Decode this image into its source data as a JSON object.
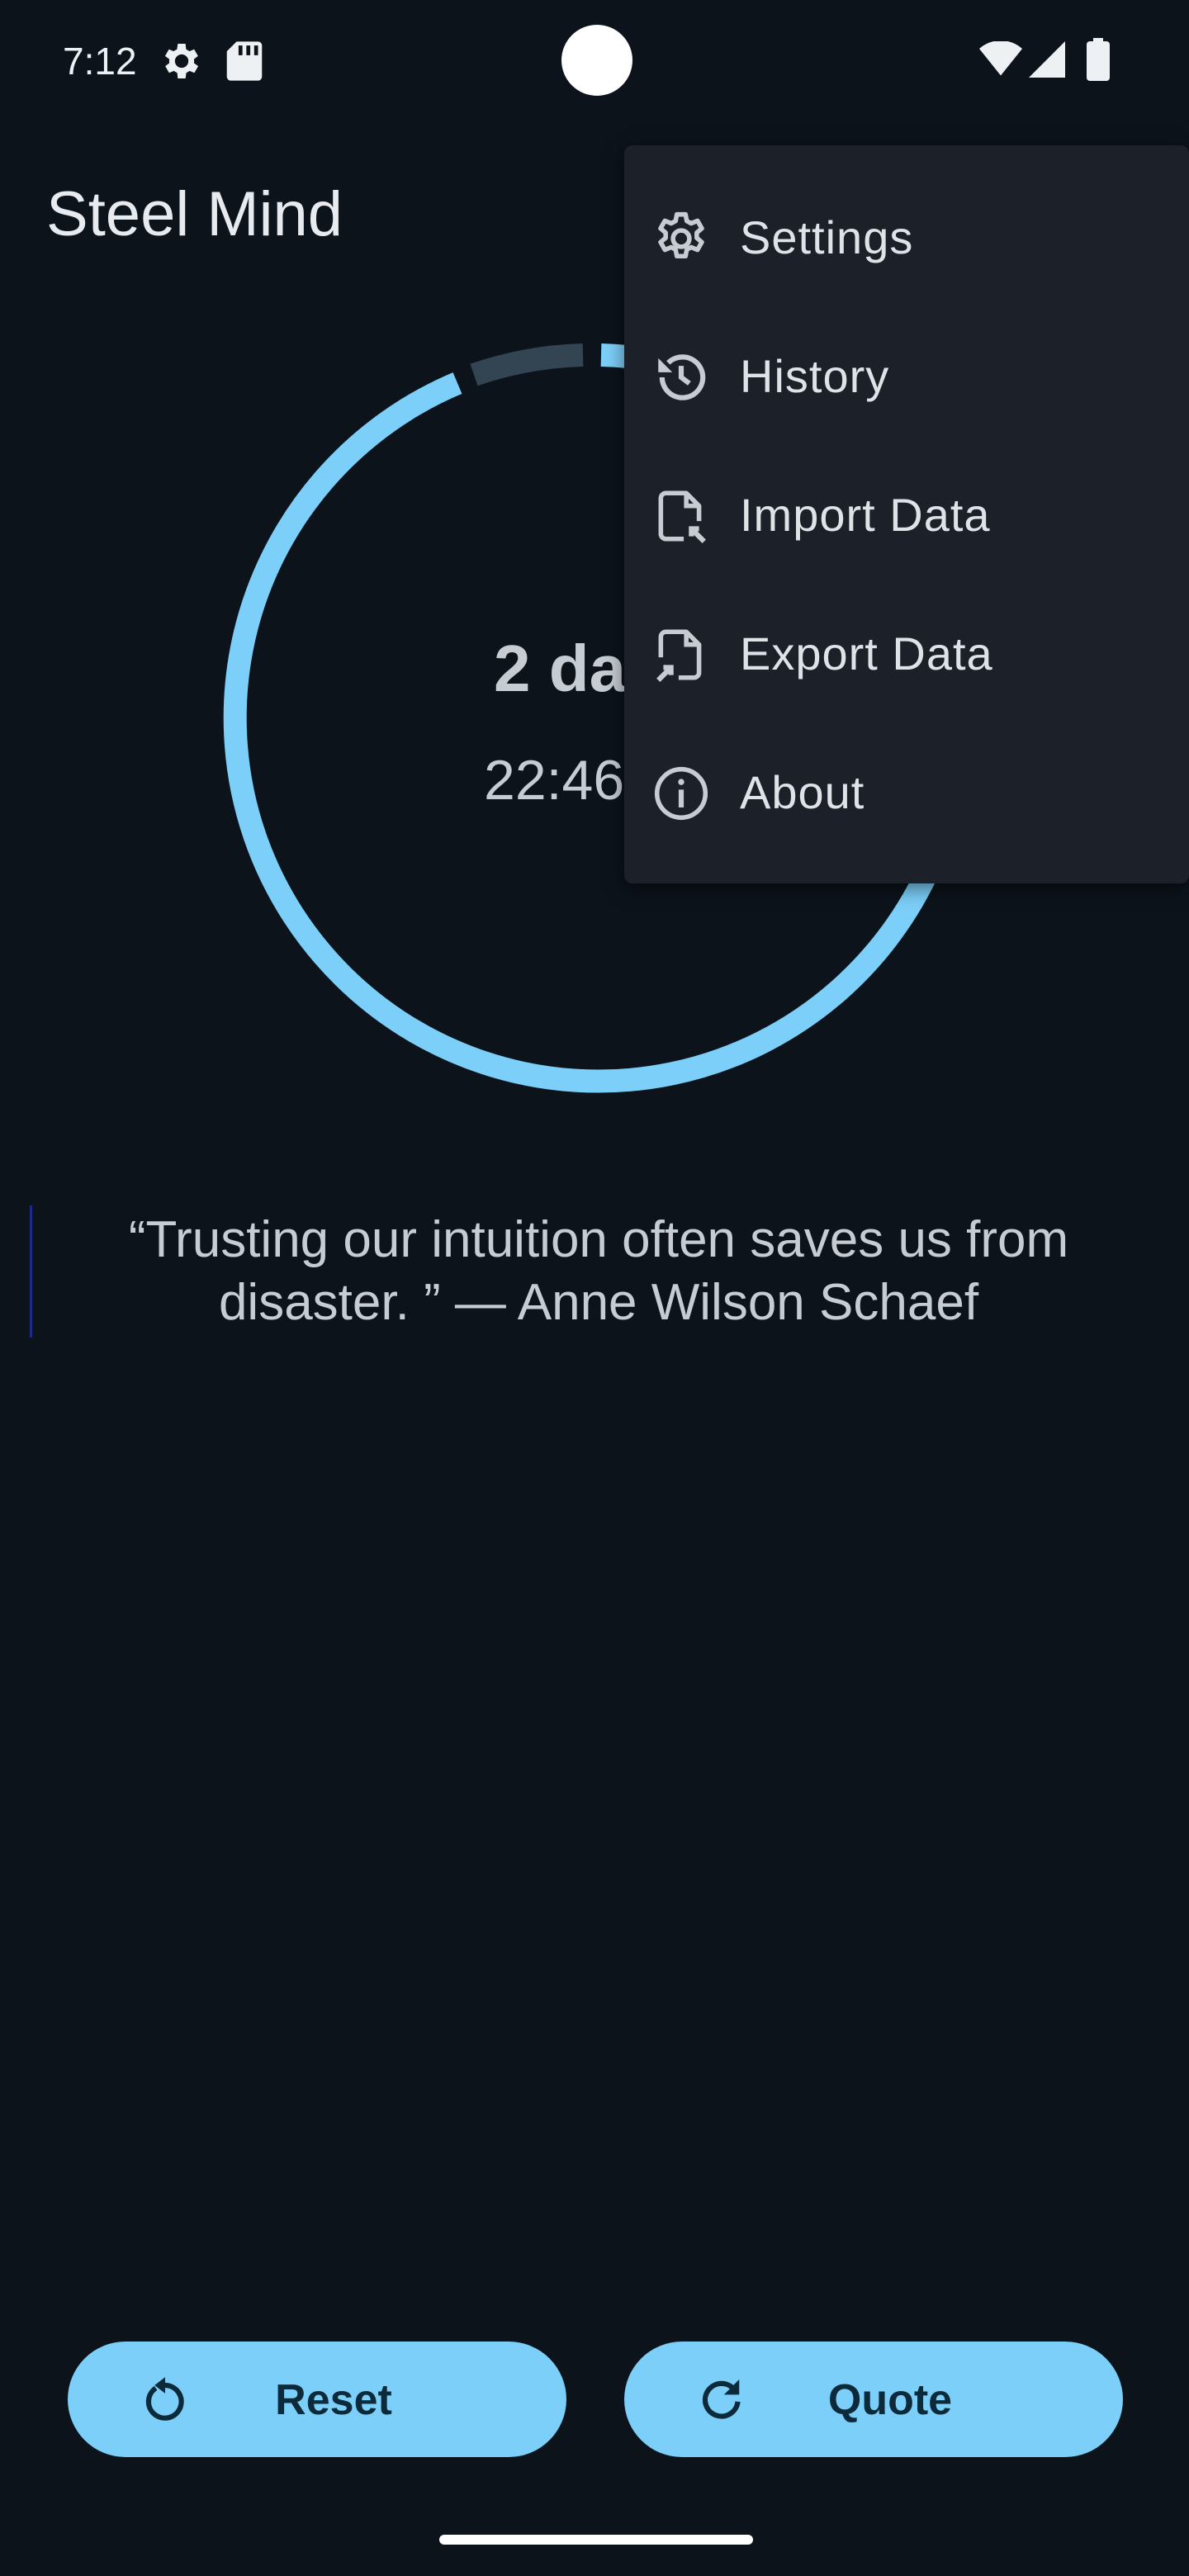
{
  "status_bar": {
    "time": "7:12",
    "icons": [
      "gear-icon",
      "sd-card-icon",
      "wifi-icon",
      "signal-icon",
      "battery-icon"
    ]
  },
  "app": {
    "title": "Steel Mind"
  },
  "timer": {
    "days_text": "2 da",
    "time_text": "22:46",
    "accent_color": "#7ccff9",
    "track_color": "#334553"
  },
  "menu": {
    "items": [
      {
        "label": "Settings",
        "icon": "settings-gear-icon"
      },
      {
        "label": "History",
        "icon": "history-icon"
      },
      {
        "label": "Import Data",
        "icon": "import-file-icon"
      },
      {
        "label": "Export Data",
        "icon": "export-file-icon"
      },
      {
        "label": "About",
        "icon": "info-icon"
      }
    ]
  },
  "quote": {
    "text": "“Trusting our intuition often saves us from disaster. ” — Anne Wilson Schaef"
  },
  "buttons": {
    "reset_label": "Reset",
    "quote_label": "Quote"
  }
}
